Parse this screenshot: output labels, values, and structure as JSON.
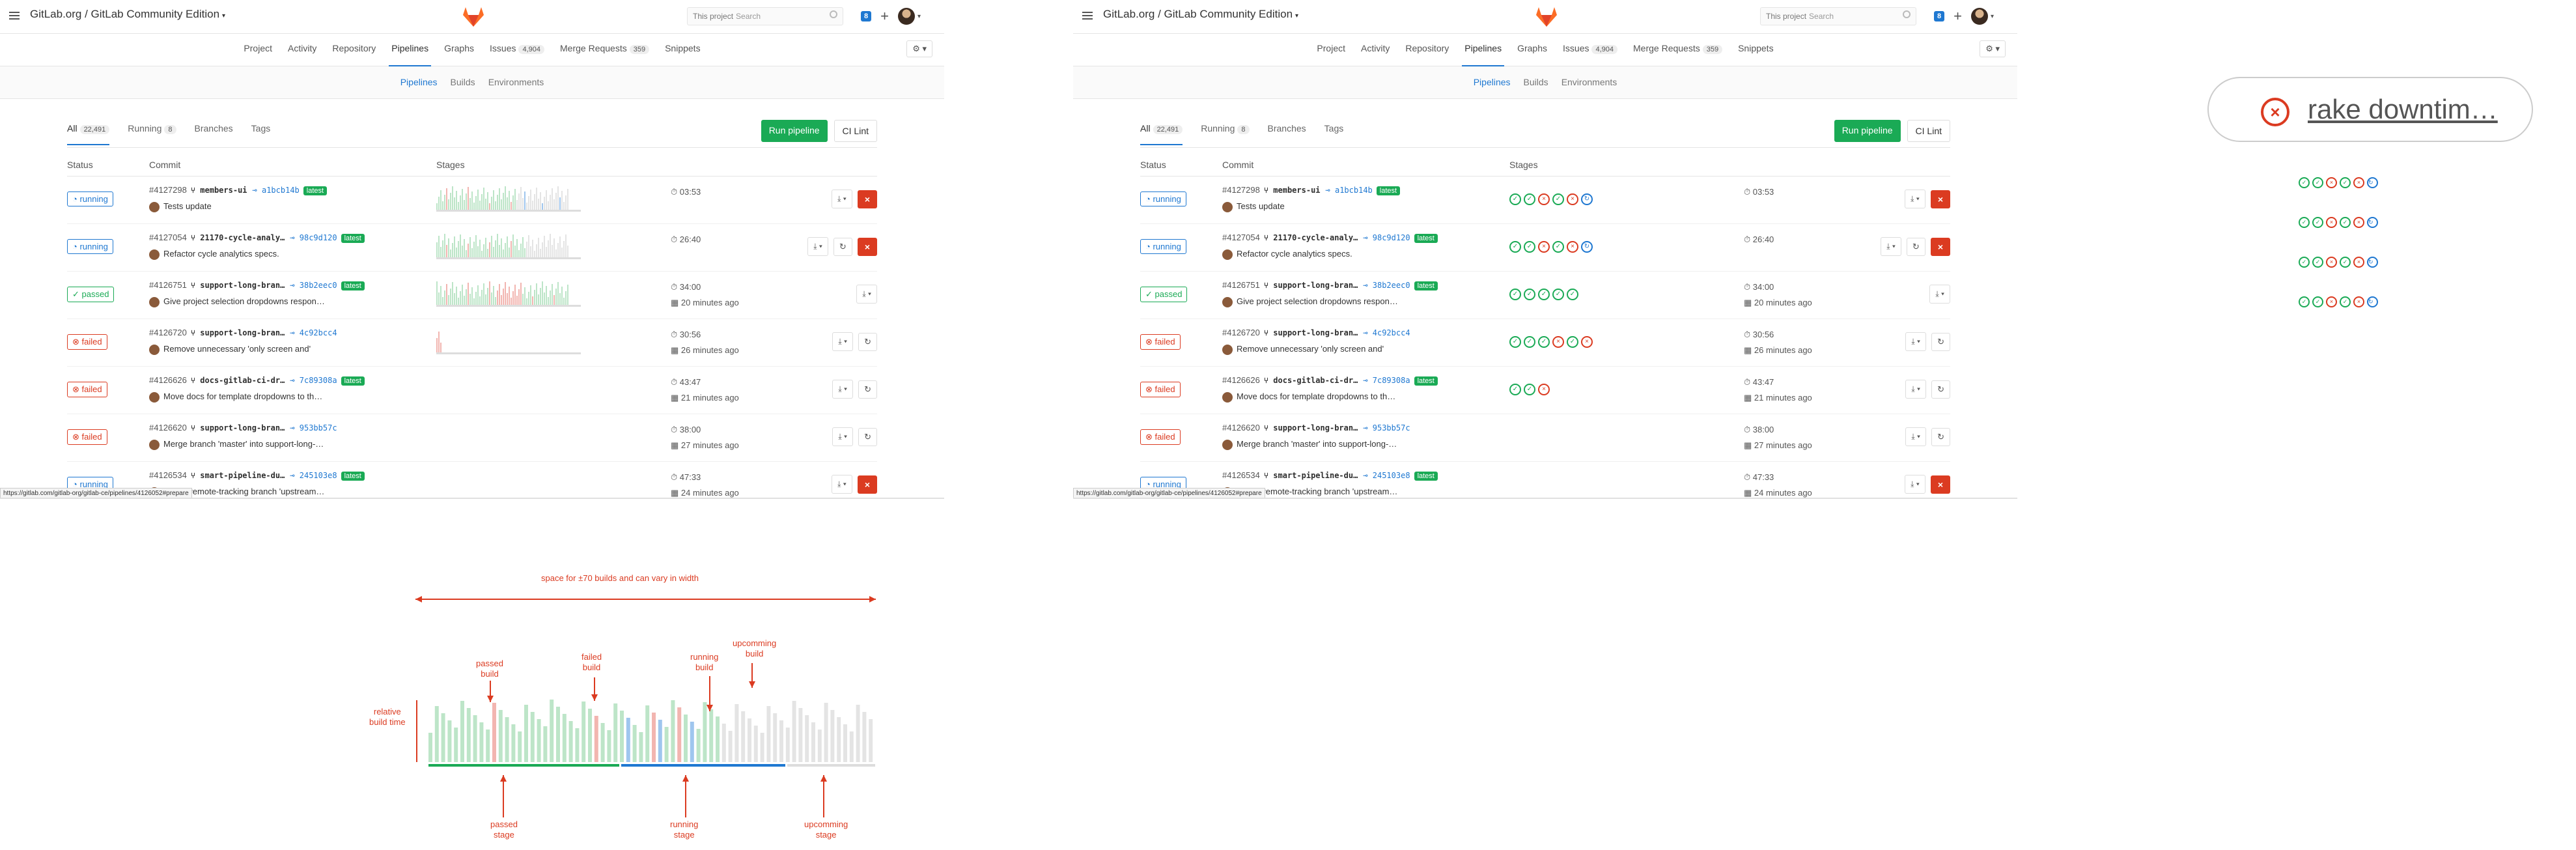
{
  "header": {
    "title": "GitLab.org / GitLab Community Edition",
    "search_scope": "This project",
    "search_placeholder": "Search",
    "todo_count": "8"
  },
  "nav": [
    {
      "label": "Project",
      "count": ""
    },
    {
      "label": "Activity",
      "count": ""
    },
    {
      "label": "Repository",
      "count": ""
    },
    {
      "label": "Pipelines",
      "count": "",
      "active": true
    },
    {
      "label": "Graphs",
      "count": ""
    },
    {
      "label": "Issues",
      "count": "4,904"
    },
    {
      "label": "Merge Requests",
      "count": "359"
    },
    {
      "label": "Snippets",
      "count": ""
    }
  ],
  "subnav": [
    "Pipelines",
    "Builds",
    "Environments"
  ],
  "scopes": [
    {
      "label": "All",
      "count": "22,491"
    },
    {
      "label": "Running",
      "count": "8"
    },
    {
      "label": "Branches",
      "count": ""
    },
    {
      "label": "Tags",
      "count": ""
    }
  ],
  "buttons": {
    "run": "Run pipeline",
    "lint": "CI Lint"
  },
  "columns": {
    "status": "Status",
    "commit": "Commit",
    "stages": "Stages"
  },
  "rows": [
    {
      "status": "running",
      "id": "#4127298",
      "branch": "members-ui",
      "sha": "a1bcb14b",
      "latest": "latest",
      "message": "Tests update",
      "duration": "03:53",
      "ago": "",
      "stages": [
        "p",
        "p",
        "f",
        "p",
        "f",
        "r"
      ]
    },
    {
      "status": "running",
      "id": "#4127054",
      "branch": "21170-cycle-analy…",
      "sha": "98c9d120",
      "latest": "latest",
      "message": "Refactor cycle analytics specs.",
      "duration": "26:40",
      "ago": "",
      "stages": [
        "p",
        "p",
        "f",
        "p",
        "f",
        "r"
      ]
    },
    {
      "status": "passed",
      "id": "#4126751",
      "branch": "support-long-bran…",
      "sha": "38b2eec0",
      "latest": "latest",
      "message": "Give project selection dropdowns respon…",
      "duration": "34:00",
      "ago": "20 minutes ago",
      "stages": [
        "p",
        "p",
        "p",
        "p",
        "p"
      ]
    },
    {
      "status": "failed",
      "id": "#4126720",
      "branch": "support-long-bran…",
      "sha": "4c92bcc4",
      "latest": "",
      "message": "Remove unnecessary 'only screen and'",
      "duration": "30:56",
      "ago": "26 minutes ago",
      "stages": [
        "p",
        "p",
        "p",
        "f",
        "p",
        "f"
      ]
    },
    {
      "status": "failed",
      "id": "#4126626",
      "branch": "docs-gitlab-ci-dr…",
      "sha": "7c89308a",
      "latest": "latest",
      "message": "Move docs for template dropdowns to th…",
      "duration": "43:47",
      "ago": "21 minutes ago",
      "stages": [
        "p",
        "p",
        "f"
      ]
    },
    {
      "status": "failed",
      "id": "#4126620",
      "branch": "support-long-bran…",
      "sha": "953bb57c",
      "latest": "",
      "message": "Merge branch 'master' into support-long-…",
      "duration": "38:00",
      "ago": "27 minutes ago",
      "stages": []
    },
    {
      "status": "running",
      "id": "#4126534",
      "branch": "smart-pipeline-du…",
      "sha": "245103e8",
      "latest": "latest",
      "message": "Merge remote-tracking branch 'upstream…",
      "duration": "47:33",
      "ago": "24 minutes ago",
      "stages": []
    }
  ],
  "status_url": "https://gitlab.com/gitlab-org/gitlab-ce/pipelines/4126052#prepare",
  "callout": {
    "text": "rake downtim…"
  },
  "diagram": {
    "width_note": "space for ±70 builds and can vary in width",
    "passed_build": "passed\nbuild",
    "failed_build": "failed\nbuild",
    "running_build": "running\nbuild",
    "upcoming_build": "upcomming\nbuild",
    "relative": "relative\nbuild time",
    "passed_stage": "passed\nstage",
    "running_stage": "running\nstage",
    "upcoming_stage": "upcomming\nstage"
  },
  "colors": {
    "passed": "#1aaa55",
    "failed": "#db3b21",
    "running": "#1f78d1",
    "accent": "#1f78d1"
  }
}
